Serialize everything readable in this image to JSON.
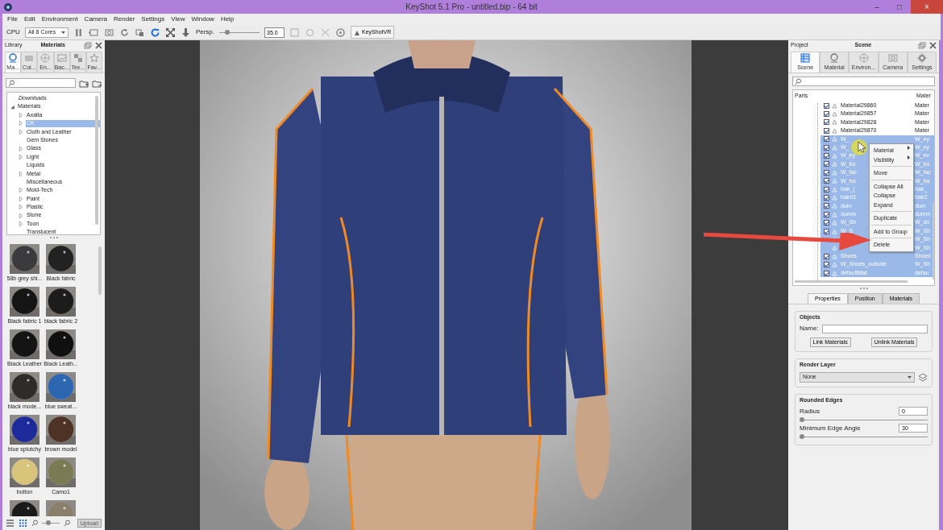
{
  "window": {
    "title": "KeyShot 5.1 Pro  - untitled.bip  - 64 bit",
    "controls": [
      "–",
      "□",
      "×"
    ]
  },
  "menu": [
    "File",
    "Edit",
    "Environment",
    "Camera",
    "Render",
    "Settings",
    "View",
    "Window",
    "Help"
  ],
  "toolbar": {
    "cpu_label": "CPU",
    "cores": "All 8 Cores",
    "projection": "Persp.",
    "fov_slider": {
      "level": 0.2
    },
    "fov_value": "35.0",
    "vr_button": "KeyShotVR"
  },
  "library": {
    "title": "Library",
    "heading": "Materials",
    "tabs": [
      {
        "label": "Ma...",
        "selected": true
      },
      {
        "label": "Col...",
        "selected": false
      },
      {
        "label": "En...",
        "selected": false
      },
      {
        "label": "Bac...",
        "selected": false
      },
      {
        "label": "Tex...",
        "selected": false
      },
      {
        "label": "Fav...",
        "selected": false
      }
    ],
    "tree": [
      {
        "label": "Downloads",
        "kind": "shortcut"
      },
      {
        "label": "Materials",
        "kind": "folder",
        "expanded": true,
        "children": [
          {
            "label": "Axalta",
            "expandable": true,
            "selected": false
          },
          {
            "label": "CK",
            "expandable": true,
            "selected": true
          },
          {
            "label": "Cloth and Leather",
            "expandable": true,
            "selected": false
          },
          {
            "label": "Gem Stones",
            "expandable": false,
            "selected": false
          },
          {
            "label": "Glass",
            "expandable": true,
            "selected": false
          },
          {
            "label": "Light",
            "expandable": true,
            "selected": false
          },
          {
            "label": "Liquids",
            "expandable": false,
            "selected": false
          },
          {
            "label": "Metal",
            "expandable": true,
            "selected": false
          },
          {
            "label": "Miscellaneous",
            "expandable": false,
            "selected": false
          },
          {
            "label": "Mold-Tech",
            "expandable": true,
            "selected": false
          },
          {
            "label": "Paint",
            "expandable": true,
            "selected": false
          },
          {
            "label": "Plastic",
            "expandable": true,
            "selected": false
          },
          {
            "label": "Stone",
            "expandable": true,
            "selected": false
          },
          {
            "label": "Toon",
            "expandable": true,
            "selected": false
          },
          {
            "label": "Translucent",
            "expandable": false,
            "selected": false
          }
        ]
      }
    ],
    "materials": [
      {
        "label": "58b grey shi...",
        "color": "#3b3b3e"
      },
      {
        "label": "Black fabric",
        "color": "#222222"
      },
      {
        "label": "Black fabric 1",
        "color": "#151515"
      },
      {
        "label": "black fabric 2",
        "color": "#1c1c1c"
      },
      {
        "label": "Black Leather",
        "color": "#141414"
      },
      {
        "label": "Black Leath...",
        "color": "#101010"
      },
      {
        "label": "black mode...",
        "color": "#2e2c2a"
      },
      {
        "label": "blue  sweat...",
        "color": "#2d66b0"
      },
      {
        "label": "blue splotchy",
        "color": "#1c2a9a"
      },
      {
        "label": "brown model",
        "color": "#4e3325"
      },
      {
        "label": "button",
        "color": "#d8c47a"
      },
      {
        "label": "Camo1",
        "color": "#7a7a55"
      },
      {
        "color": "#1a1a1a"
      },
      {
        "color": "#8a7f6a"
      }
    ],
    "view_modes": [
      {
        "kind": "list",
        "selected": false
      },
      {
        "kind": "grid",
        "selected": true
      }
    ],
    "zoom_slider": {
      "level": 0.35
    },
    "upload": {
      "label": "Upload",
      "disabled": true
    }
  },
  "project": {
    "title": "Project",
    "heading": "Scene",
    "tabs": [
      {
        "label": "Scene",
        "selected": true
      },
      {
        "label": "Material",
        "selected": false
      },
      {
        "label": "Environ...",
        "selected": false
      },
      {
        "label": "Camera",
        "selected": false
      },
      {
        "label": "Settings",
        "selected": false
      }
    ],
    "columns": [
      "Parts",
      "Mater"
    ],
    "parts": [
      {
        "name": "Material29860",
        "material": "Mater",
        "checked": true,
        "selected": false
      },
      {
        "name": "Material29857",
        "material": "Mater",
        "checked": true,
        "selected": false
      },
      {
        "name": "Material29828",
        "material": "Mater",
        "checked": true,
        "selected": false
      },
      {
        "name": "Material29870",
        "material": "Mater",
        "checked": true,
        "selected": false
      },
      {
        "name": "W_",
        "material": "W_ey",
        "checked": true,
        "selected": true
      },
      {
        "name": "W_",
        "material": "W_ey",
        "checked": true,
        "selected": true
      },
      {
        "name": "W_ey",
        "material": "W_ev",
        "checked": true,
        "selected": true
      },
      {
        "name": "W_bo",
        "material": "W_bo",
        "checked": true,
        "selected": true
      },
      {
        "name": "W_fac",
        "material": "W_fac",
        "checked": true,
        "selected": true
      },
      {
        "name": "W_ha",
        "material": "W_ha",
        "checked": true,
        "selected": true
      },
      {
        "name": "hair_j",
        "material": "hair_",
        "checked": true,
        "selected": true
      },
      {
        "name": "hair01",
        "material": "hair2",
        "checked": true,
        "selected": true
      },
      {
        "name": "dum",
        "material": "dum",
        "checked": true,
        "selected": true
      },
      {
        "name": "dumm",
        "material": "dumm",
        "checked": true,
        "selected": true
      },
      {
        "name": "W_Sh",
        "material": "W_sh",
        "checked": true,
        "selected": true
      },
      {
        "name": "W_S",
        "material": "W_Sh",
        "checked": true,
        "selected": true
      },
      {
        "material": "W_Sh",
        "selected": true
      },
      {
        "material": "W_Sh",
        "selected": true
      },
      {
        "name": "Shoes",
        "material": "Shoes",
        "checked": true,
        "selected": true
      },
      {
        "name": "W_Shoes_outsole",
        "material": "W_Sh",
        "checked": true,
        "selected": true
      },
      {
        "name": "defaultMat",
        "material": "defau",
        "checked": true,
        "selected": true
      }
    ],
    "context_menu": [
      {
        "label": "Material",
        "submenu": true,
        "separator_before": false
      },
      {
        "label": "Visibility",
        "submenu": true,
        "separator_before": false
      },
      {
        "label": "Move",
        "submenu": false,
        "separator_before": true
      },
      {
        "label": "Collapse All",
        "submenu": false,
        "separator_before": true
      },
      {
        "label": "Collapse",
        "submenu": false,
        "separator_before": false
      },
      {
        "label": "Expand",
        "submenu": false,
        "separator_before": false
      },
      {
        "label": "Duplicate",
        "submenu": false,
        "separator_before": true
      },
      {
        "label": "Add to Group",
        "submenu": false,
        "separator_before": true
      },
      {
        "label": "Delete",
        "submenu": false,
        "separator_before": true
      }
    ],
    "bottom_tabs": [
      {
        "label": "Properties",
        "selected": true
      },
      {
        "label": "Position",
        "selected": false
      },
      {
        "label": "Materials",
        "selected": false
      }
    ],
    "objects": {
      "title": "Objects",
      "name_label": "Name:",
      "buttons": [
        "Link Materials",
        "Unlink Materials"
      ]
    },
    "render_layer": {
      "title": "Render Layer",
      "value": "None"
    },
    "rounded_edges": {
      "title": "Rounded Edges",
      "fields": [
        {
          "label": "Radius",
          "value": "0",
          "level": 0
        },
        {
          "label": "Minimum Edge Angle",
          "value": "30",
          "level": 0
        }
      ]
    }
  }
}
